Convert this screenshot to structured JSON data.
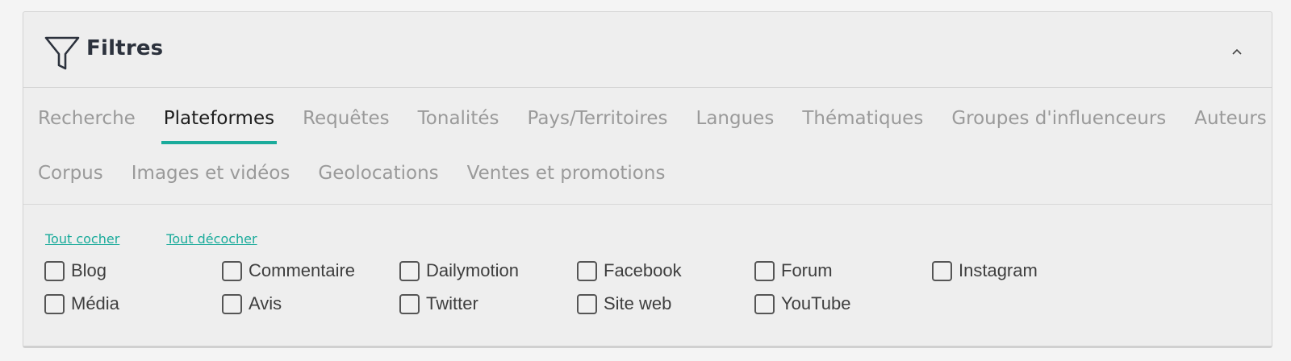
{
  "panel": {
    "title": "Filtres",
    "icons": {
      "filter": "filter-funnel-icon",
      "collapse": "chevron-up-icon"
    }
  },
  "tabs": {
    "row1": [
      "Recherche",
      "Plateformes",
      "Requêtes",
      "Tonalités",
      "Pays/Territoires",
      "Langues",
      "Thématiques",
      "Groupes d'influenceurs",
      "Auteurs"
    ],
    "row2": [
      "Corpus",
      "Images et vidéos",
      "Geolocations",
      "Ventes et promotions"
    ],
    "active": "Plateformes"
  },
  "links": {
    "check_all": "Tout cocher",
    "uncheck_all": "Tout décocher"
  },
  "platforms": [
    {
      "label": "Blog",
      "checked": false
    },
    {
      "label": "Commentaire",
      "checked": false
    },
    {
      "label": "Dailymotion",
      "checked": false
    },
    {
      "label": "Facebook",
      "checked": false
    },
    {
      "label": "Forum",
      "checked": false
    },
    {
      "label": "Instagram",
      "checked": false
    },
    {
      "label": "Média",
      "checked": false
    },
    {
      "label": "Avis",
      "checked": false
    },
    {
      "label": "Twitter",
      "checked": false
    },
    {
      "label": "Site web",
      "checked": false
    },
    {
      "label": "YouTube",
      "checked": false
    }
  ],
  "colors": {
    "accent": "#1aab9b",
    "title": "#2c323d",
    "inactive_tab": "#9a9a9a"
  }
}
